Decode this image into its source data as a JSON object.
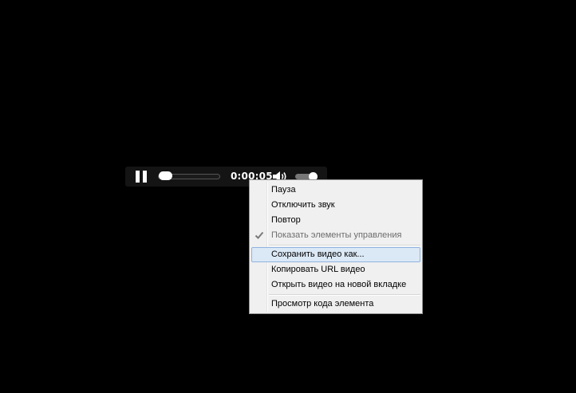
{
  "player": {
    "timecode": "0:00:05",
    "seek_progress": 0.0,
    "volume_level": 1.0
  },
  "context_menu": {
    "items": [
      {
        "label": "Пауза",
        "enabled": true
      },
      {
        "label": "Отключить звук",
        "enabled": true
      },
      {
        "label": "Повтор",
        "enabled": true
      },
      {
        "label": "Показать элементы управления",
        "enabled": false,
        "checked": true
      },
      {
        "label": "Сохранить видео как...",
        "enabled": true,
        "highlighted": true
      },
      {
        "label": "Копировать URL видео",
        "enabled": true
      },
      {
        "label": "Открыть видео на новой вкладке",
        "enabled": true
      },
      {
        "label": "Просмотр кода элемента",
        "enabled": true
      }
    ]
  },
  "icons": {
    "pause": "pause-icon",
    "volume": "speaker-volume-icon",
    "check": "checkmark-icon"
  },
  "colors": {
    "background": "#000000",
    "controls_bg": "#141414",
    "menu_bg": "#f0f0f0",
    "menu_highlight": "#dbe8f5",
    "menu_highlight_border": "#8fb3e0",
    "disabled_text": "#6d6d6d"
  }
}
